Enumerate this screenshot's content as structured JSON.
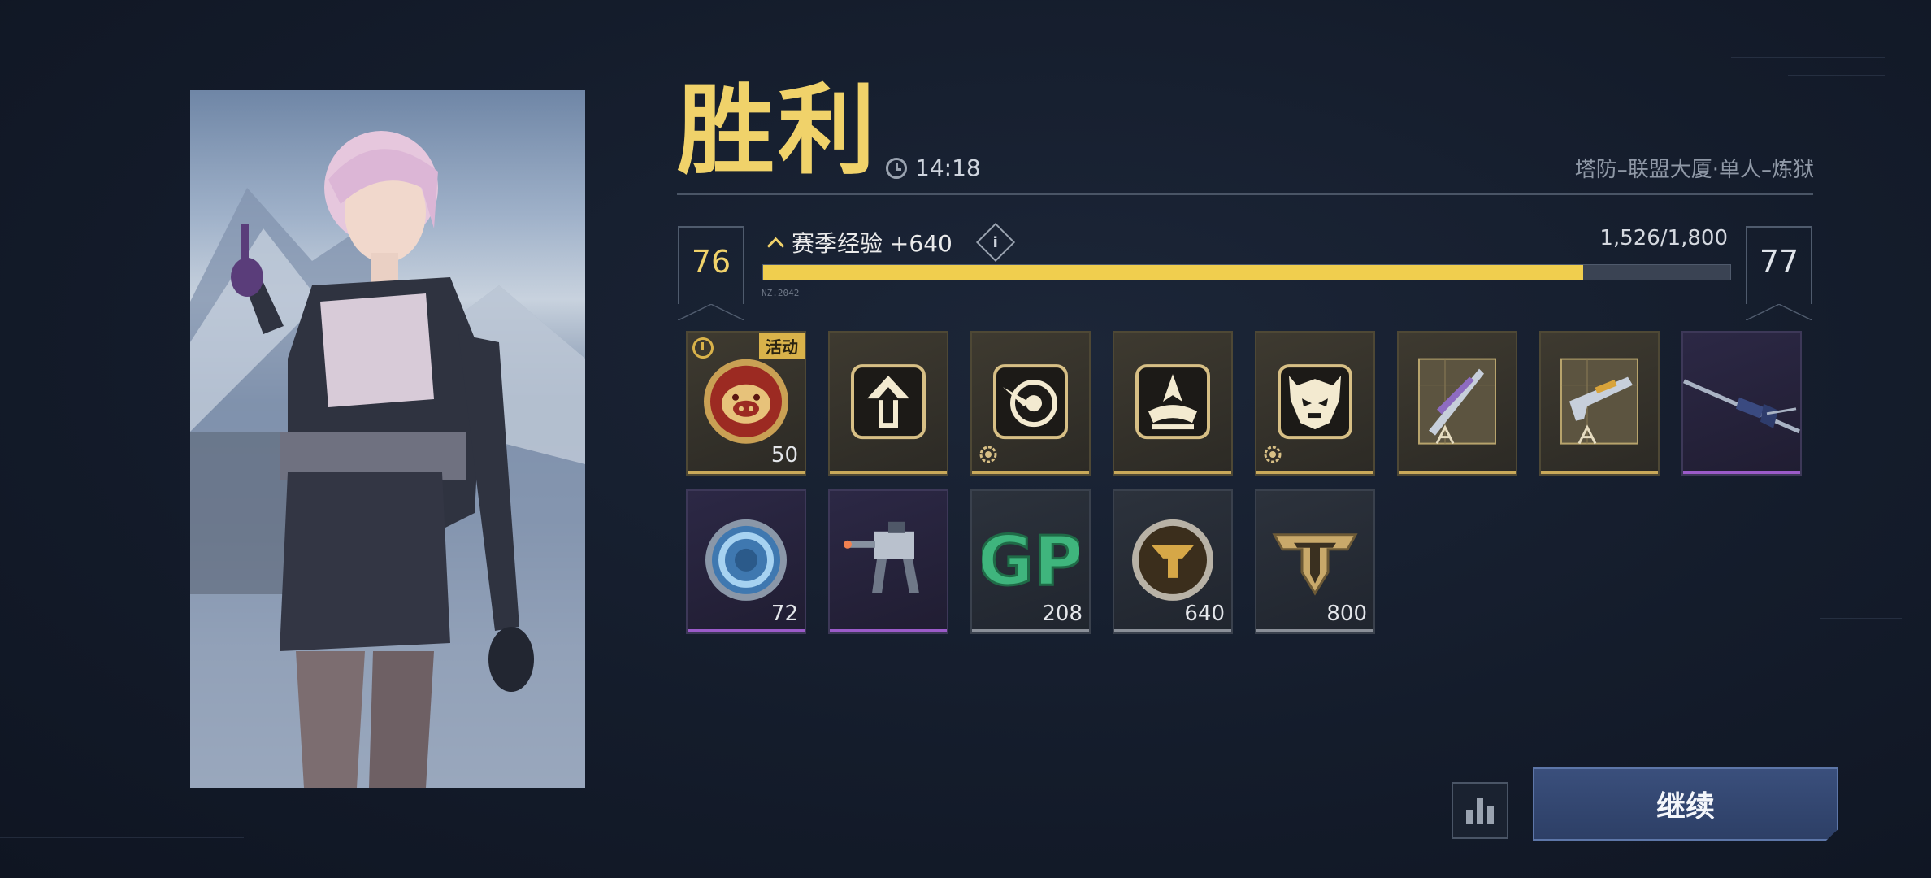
{
  "result": {
    "title": "胜利",
    "time": "14:18",
    "mode": "塔防–联盟大厦·单人–炼狱"
  },
  "level": {
    "current": "76",
    "next": "77",
    "xp_label": "赛季经验 +640",
    "info_label": "i",
    "xp_count": "1,526/1,800",
    "progress": 0.848,
    "bar_tag": "NZ.2042"
  },
  "rewards": [
    {
      "icon": "pig-token-icon",
      "rarity": "gold",
      "qty": "50",
      "badge": "活动",
      "timed": true
    },
    {
      "icon": "arrow-boost-icon",
      "rarity": "gold",
      "qty": ""
    },
    {
      "icon": "target-dart-icon",
      "rarity": "gold",
      "qty": "",
      "gear": true
    },
    {
      "icon": "flame-crown-icon",
      "rarity": "gold",
      "qty": ""
    },
    {
      "icon": "demon-mask-icon",
      "rarity": "gold",
      "qty": "",
      "gear": true
    },
    {
      "icon": "blueprint-knives-icon",
      "rarity": "gold",
      "qty": ""
    },
    {
      "icon": "blueprint-pistol-icon",
      "rarity": "gold",
      "qty": ""
    },
    {
      "icon": "rifle-icon",
      "rarity": "purple",
      "qty": ""
    },
    {
      "icon": "blue-ring-token-icon",
      "rarity": "purple",
      "qty": "72"
    },
    {
      "icon": "mech-turret-icon",
      "rarity": "purple",
      "qty": ""
    },
    {
      "icon": "gp-currency-icon",
      "rarity": "grey",
      "qty": "208",
      "text": "GP"
    },
    {
      "icon": "gold-coin-icon",
      "rarity": "grey",
      "qty": "640"
    },
    {
      "icon": "rank-emblem-icon",
      "rarity": "grey",
      "qty": "800"
    }
  ],
  "buttons": {
    "continue": "继续",
    "stats_icon": "bar-chart-icon"
  },
  "colors": {
    "gold": "#f0d26a",
    "purple": "#9b5bc9",
    "button": "#34497a"
  }
}
